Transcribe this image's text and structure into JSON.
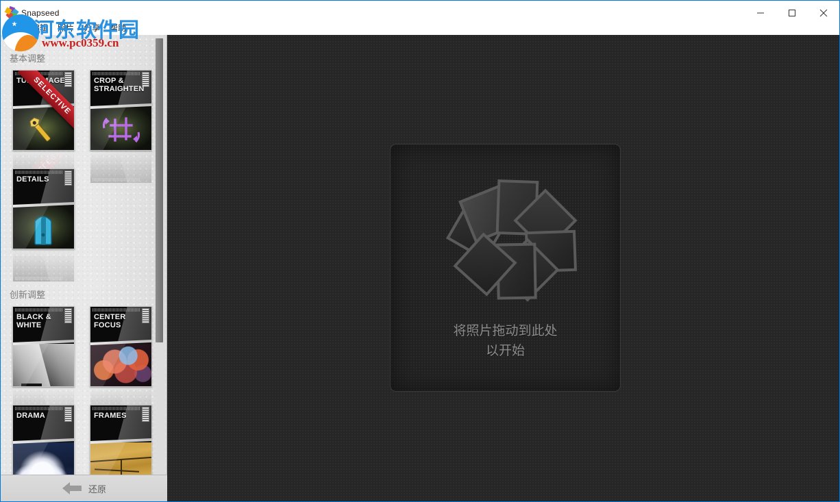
{
  "window": {
    "title": "Snapseed",
    "app_icon": "snapseed-pinwheel-icon",
    "controls": {
      "minimize": "minimize-icon",
      "maximize": "maximize-icon",
      "close": "close-icon"
    }
  },
  "menubar": {
    "items": [
      {
        "label": "文件"
      },
      {
        "label": "编辑"
      },
      {
        "label": "照片"
      },
      {
        "label": "分享"
      },
      {
        "label": "帮助"
      }
    ]
  },
  "watermark": {
    "site_name": "河东软件园",
    "url": "www.pc0359.cn",
    "logo": "pc0359-circle-logo",
    "brand_blue": "#2a90e0",
    "brand_red": "#c81e1e"
  },
  "sidebar": {
    "sections": [
      {
        "title": "基本调整",
        "tiles": [
          {
            "label": "TUNE IMAGE",
            "icon": "wrench-icon",
            "badge": "SELECTIVE"
          },
          {
            "label": "CROP & STRAIGHTEN",
            "icon": "crop-rotate-icon",
            "badge": ""
          },
          {
            "label": "DETAILS",
            "icon": "sharpener-icon",
            "badge": ""
          }
        ]
      },
      {
        "title": "创新调整",
        "tiles": [
          {
            "label": "BLACK & WHITE",
            "icon": "bw-photo-icon",
            "badge": ""
          },
          {
            "label": "CENTER FOCUS",
            "icon": "bokeh-photo-icon",
            "badge": ""
          },
          {
            "label": "DRAMA",
            "icon": "clouds-photo-icon",
            "badge": ""
          },
          {
            "label": "FRAMES",
            "icon": "frames-photo-icon",
            "badge": ""
          }
        ]
      }
    ],
    "scrollbar": {
      "name": "sidebar-scrollbar"
    }
  },
  "bottombar": {
    "revert_label": "还原",
    "revert_icon": "back-arrow-icon"
  },
  "canvas": {
    "dropzone": {
      "logo": "snapseed-pinwheel-logo",
      "line1": "将照片拖动到此处",
      "line2": "以开始"
    },
    "background_color": "#262626"
  }
}
